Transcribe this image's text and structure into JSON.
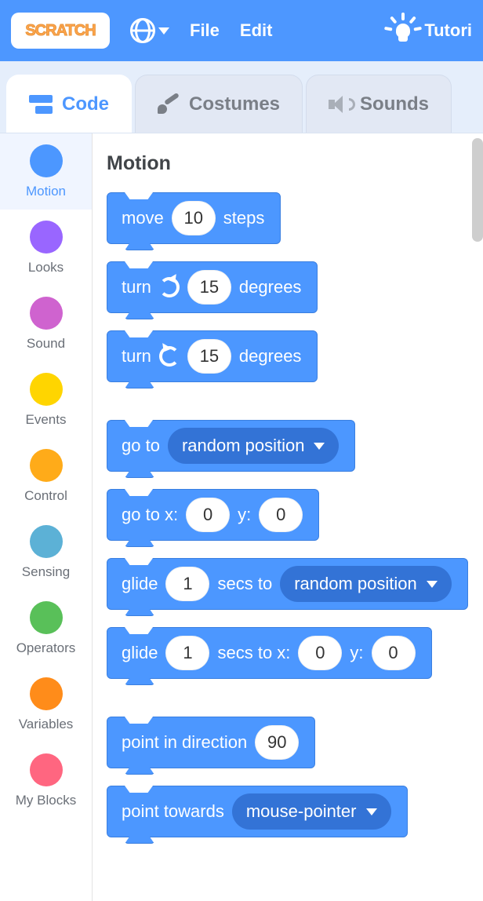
{
  "header": {
    "logo_text": "SCRATCH",
    "file": "File",
    "edit": "Edit",
    "tutorials": "Tutori"
  },
  "tabs": {
    "code": "Code",
    "costumes": "Costumes",
    "sounds": "Sounds"
  },
  "categories": [
    {
      "name": "Motion",
      "color": "d-motion",
      "active": true
    },
    {
      "name": "Looks",
      "color": "d-looks"
    },
    {
      "name": "Sound",
      "color": "d-sound"
    },
    {
      "name": "Events",
      "color": "d-events"
    },
    {
      "name": "Control",
      "color": "d-control"
    },
    {
      "name": "Sensing",
      "color": "d-sensing"
    },
    {
      "name": "Operators",
      "color": "d-operators"
    },
    {
      "name": "Variables",
      "color": "d-variables"
    },
    {
      "name": "My Blocks",
      "color": "d-myblocks"
    }
  ],
  "workspace": {
    "heading": "Motion",
    "blocks": {
      "move": {
        "pre": "move",
        "val": "10",
        "post": "steps"
      },
      "turn_cw": {
        "pre": "turn",
        "val": "15",
        "post": "degrees"
      },
      "turn_ccw": {
        "pre": "turn",
        "val": "15",
        "post": "degrees"
      },
      "goto_menu": {
        "pre": "go to",
        "menu": "random position"
      },
      "goto_xy": {
        "pre": "go to x:",
        "x": "0",
        "mid": "y:",
        "y": "0"
      },
      "glide_menu": {
        "pre": "glide",
        "secs": "1",
        "mid": "secs to",
        "menu": "random position"
      },
      "glide_xy": {
        "pre": "glide",
        "secs": "1",
        "mid": "secs to x:",
        "x": "0",
        "mid2": "y:",
        "y": "0"
      },
      "point_dir": {
        "pre": "point in direction",
        "val": "90"
      },
      "point_towards": {
        "pre": "point towards",
        "menu": "mouse-pointer"
      }
    }
  }
}
